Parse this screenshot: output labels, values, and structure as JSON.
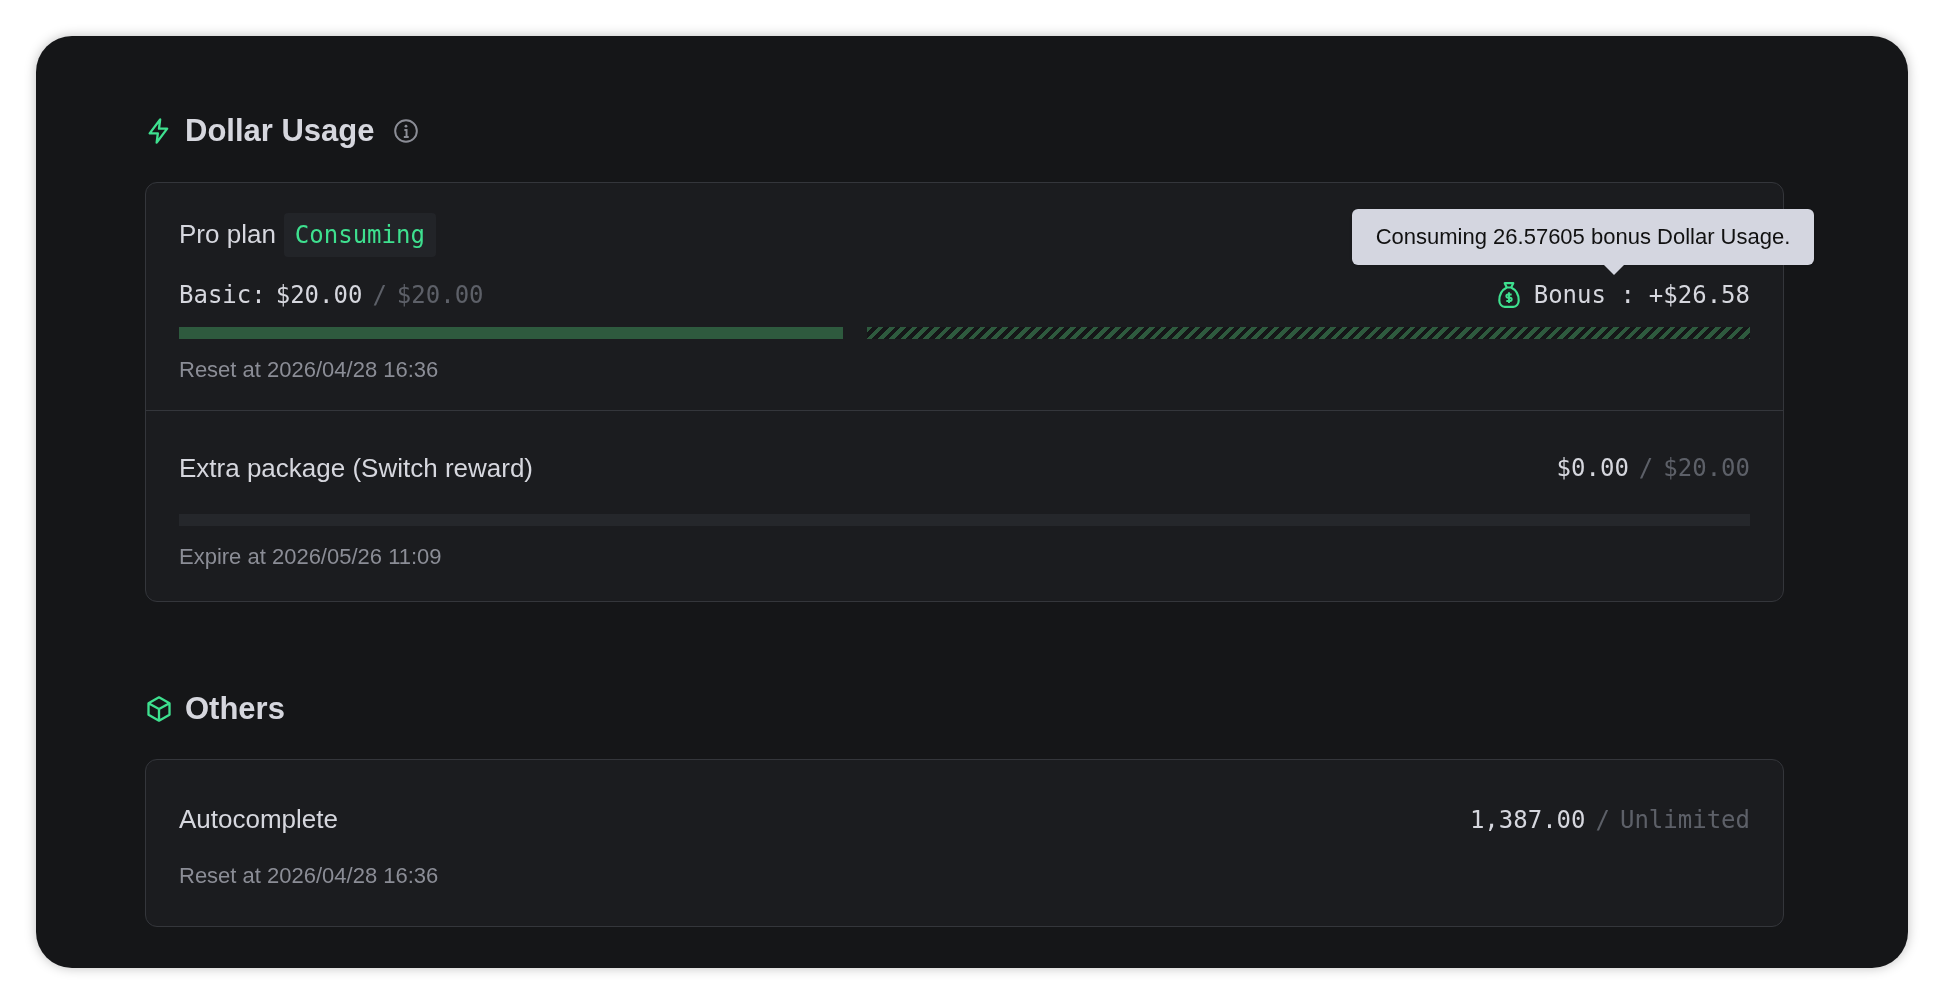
{
  "sections": [
    {
      "title": "Dollar Usage",
      "cards": [
        {
          "kind": "plan",
          "name": "Pro plan",
          "badge": "Consuming",
          "basic_label": "Basic:",
          "used": "$20.00",
          "separator": "/",
          "limit": "$20.00",
          "level": 1,
          "bonus": {
            "label": "Bonus :",
            "amount": "+$26.58",
            "level": 1
          },
          "note": "Reset at 2026/04/28 16:36",
          "tooltip": "Consuming 26.57605 bonus Dollar Usage."
        },
        {
          "kind": "meter",
          "name": "Extra package (Switch reward)",
          "used": "$0.00",
          "separator": "/",
          "limit": "$20.00",
          "level": 0,
          "note": "Expire at 2026/05/26 11:09"
        }
      ]
    },
    {
      "title": "Others",
      "cards": [
        {
          "kind": "count",
          "name": "Autocomplete",
          "used": "1,387.00",
          "separator": "/",
          "limit": "Unlimited",
          "note": "Reset at 2026/04/28 16:36"
        }
      ]
    }
  ]
}
